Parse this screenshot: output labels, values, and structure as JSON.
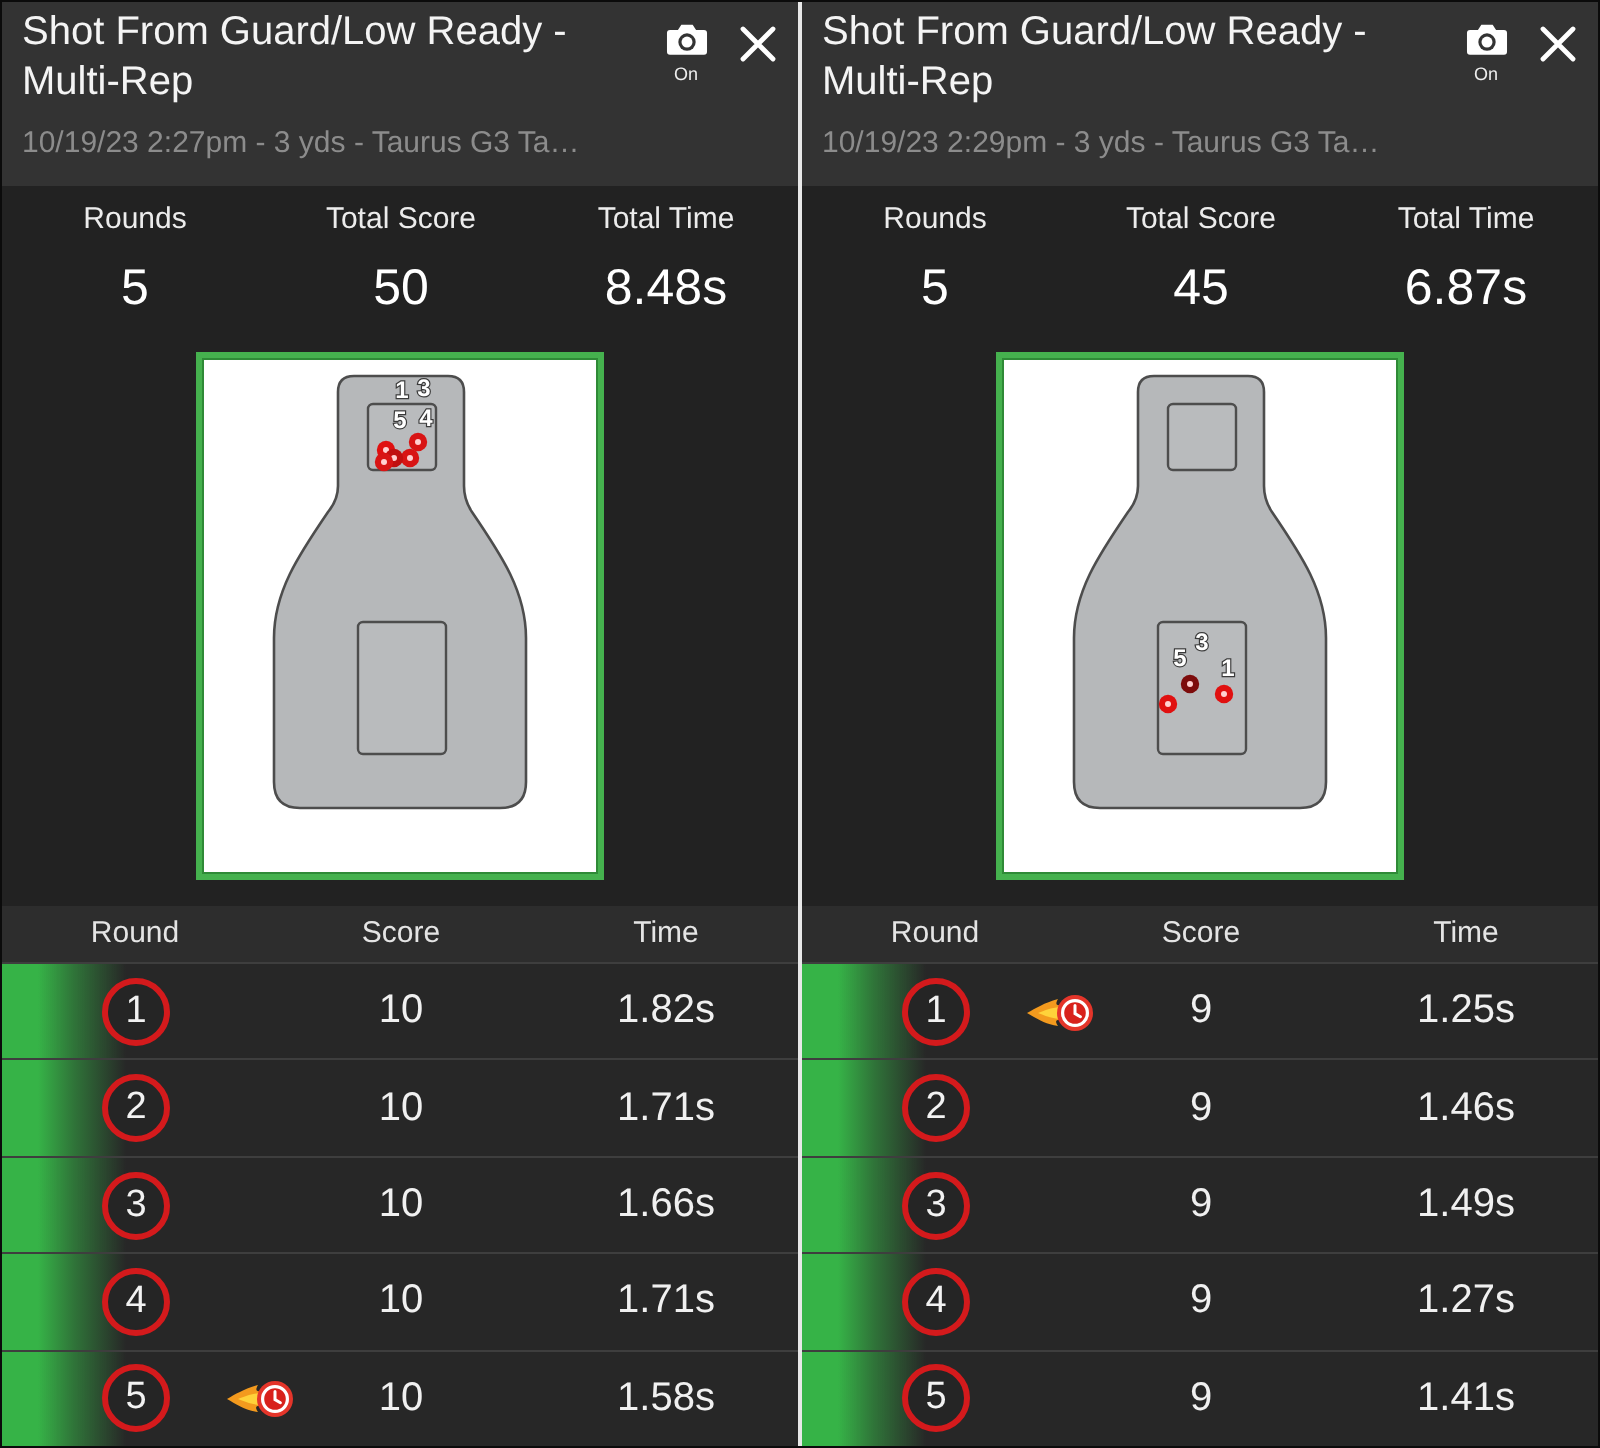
{
  "panels": [
    {
      "title": "Shot From Guard/Low Ready - Multi-Rep",
      "camera_label": "On",
      "subtitle": "10/19/23 2:27pm - 3 yds - Taurus G3 Ta…",
      "stats": [
        {
          "label": "Rounds",
          "value": "5"
        },
        {
          "label": "Total Score",
          "value": "50"
        },
        {
          "label": "Total Time",
          "value": "8.48s"
        }
      ],
      "target": {
        "shot_labels": [
          "1",
          "3",
          "5",
          "4"
        ]
      },
      "table": {
        "columns": [
          "Round",
          "Score",
          "Time"
        ],
        "rows": [
          {
            "round": "1",
            "score": "10",
            "time": "1.82s",
            "fastest": false
          },
          {
            "round": "2",
            "score": "10",
            "time": "1.71s",
            "fastest": false
          },
          {
            "round": "3",
            "score": "10",
            "time": "1.66s",
            "fastest": false
          },
          {
            "round": "4",
            "score": "10",
            "time": "1.71s",
            "fastest": false
          },
          {
            "round": "5",
            "score": "10",
            "time": "1.58s",
            "fastest": true
          }
        ]
      }
    },
    {
      "title": "Shot From Guard/Low Ready - Multi-Rep",
      "camera_label": "On",
      "subtitle": "10/19/23 2:29pm - 3 yds - Taurus G3 Ta…",
      "stats": [
        {
          "label": "Rounds",
          "value": "5"
        },
        {
          "label": "Total Score",
          "value": "45"
        },
        {
          "label": "Total Time",
          "value": "6.87s"
        }
      ],
      "target": {
        "shot_labels": [
          "5",
          "3",
          "1"
        ]
      },
      "table": {
        "columns": [
          "Round",
          "Score",
          "Time"
        ],
        "rows": [
          {
            "round": "1",
            "score": "9",
            "time": "1.25s",
            "fastest": true
          },
          {
            "round": "2",
            "score": "9",
            "time": "1.46s",
            "fastest": false
          },
          {
            "round": "3",
            "score": "9",
            "time": "1.49s",
            "fastest": false
          },
          {
            "round": "4",
            "score": "9",
            "time": "1.27s",
            "fastest": false
          },
          {
            "round": "5",
            "score": "9",
            "time": "1.41s",
            "fastest": false
          }
        ]
      }
    }
  ]
}
